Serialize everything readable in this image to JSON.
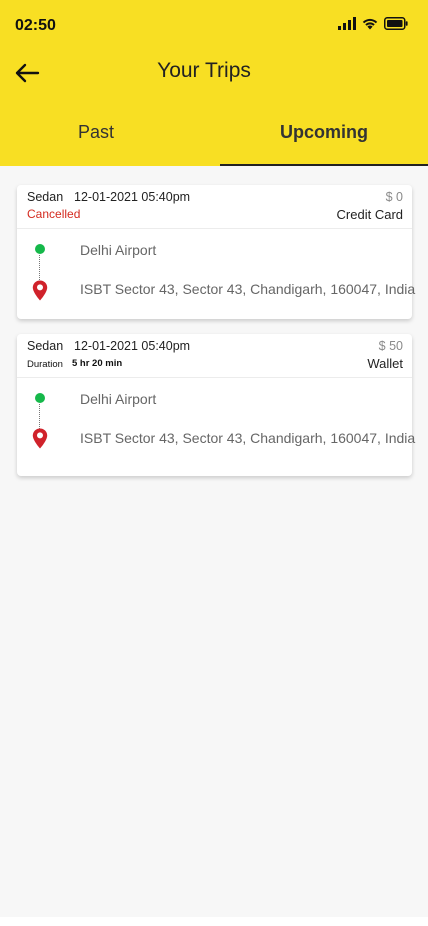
{
  "status_bar": {
    "time": "02:50",
    "icons": [
      "signal-icon",
      "wifi-icon",
      "battery-icon"
    ]
  },
  "header": {
    "title": "Your Trips",
    "back_icon": "arrow-left-icon",
    "background_color": "#f8df23"
  },
  "tabs": [
    {
      "label": "Past",
      "active": false
    },
    {
      "label": "Upcoming",
      "active": true
    }
  ],
  "trips": [
    {
      "car_type": "Sedan",
      "datetime": "12-01-2021 05:40pm",
      "price": "$ 0",
      "status": "Cancelled",
      "payment": "Credit Card",
      "pickup": "Delhi Airport",
      "drop": "ISBT Sector 43, Sector 43, Chandigarh, 160047, India"
    },
    {
      "car_type": "Sedan",
      "datetime": "12-01-2021 05:40pm",
      "price": "$ 50",
      "duration_label": "Duration",
      "duration_value": "5 hr 20 min",
      "payment": "Wallet",
      "pickup": "Delhi Airport",
      "drop": "ISBT Sector 43, Sector 43, Chandigarh, 160047, India"
    }
  ],
  "colors": {
    "accent": "#f8df23",
    "cancelled": "#d42a1f",
    "pickup_dot": "#15b84a",
    "drop_pin": "#d0222b"
  }
}
